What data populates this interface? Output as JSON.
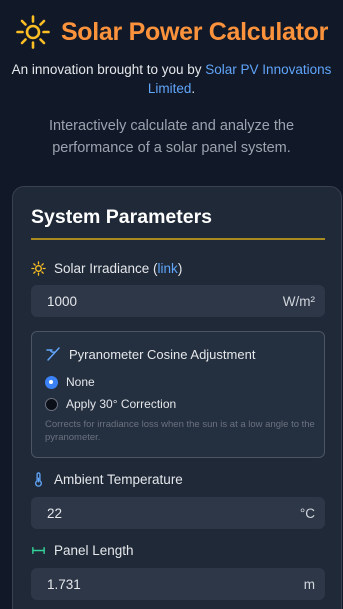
{
  "header": {
    "title": "Solar Power Calculator",
    "byline_prefix": "An innovation brought to you by ",
    "byline_link": "Solar PV Innovations Limited",
    "byline_suffix": ".",
    "intro": "Interactively calculate and analyze the performance of a solar panel system."
  },
  "colors": {
    "accent": "#fb923c",
    "link": "#60a5fa",
    "divider": "#a78b20",
    "radio": "#3b82f6"
  },
  "params": {
    "title": "System Parameters",
    "irradiance": {
      "label": "Solar Irradiance (",
      "link": "link",
      "label_end": ")",
      "value": "1000",
      "unit": "W/m²",
      "icon": "sun-icon"
    },
    "cosine": {
      "title": "Pyranometer Cosine Adjustment",
      "icon": "angle-icon",
      "options": [
        "None",
        "Apply 30° Correction"
      ],
      "selected": "None",
      "hint": "Corrects for irradiance loss when the sun is at a low angle to the pyranometer."
    },
    "temperature": {
      "label": "Ambient Temperature",
      "value": "22",
      "unit": "°C",
      "icon": "thermometer-icon"
    },
    "length": {
      "label": "Panel Length",
      "value": "1.731",
      "unit": "m",
      "icon": "ruler-icon"
    }
  }
}
